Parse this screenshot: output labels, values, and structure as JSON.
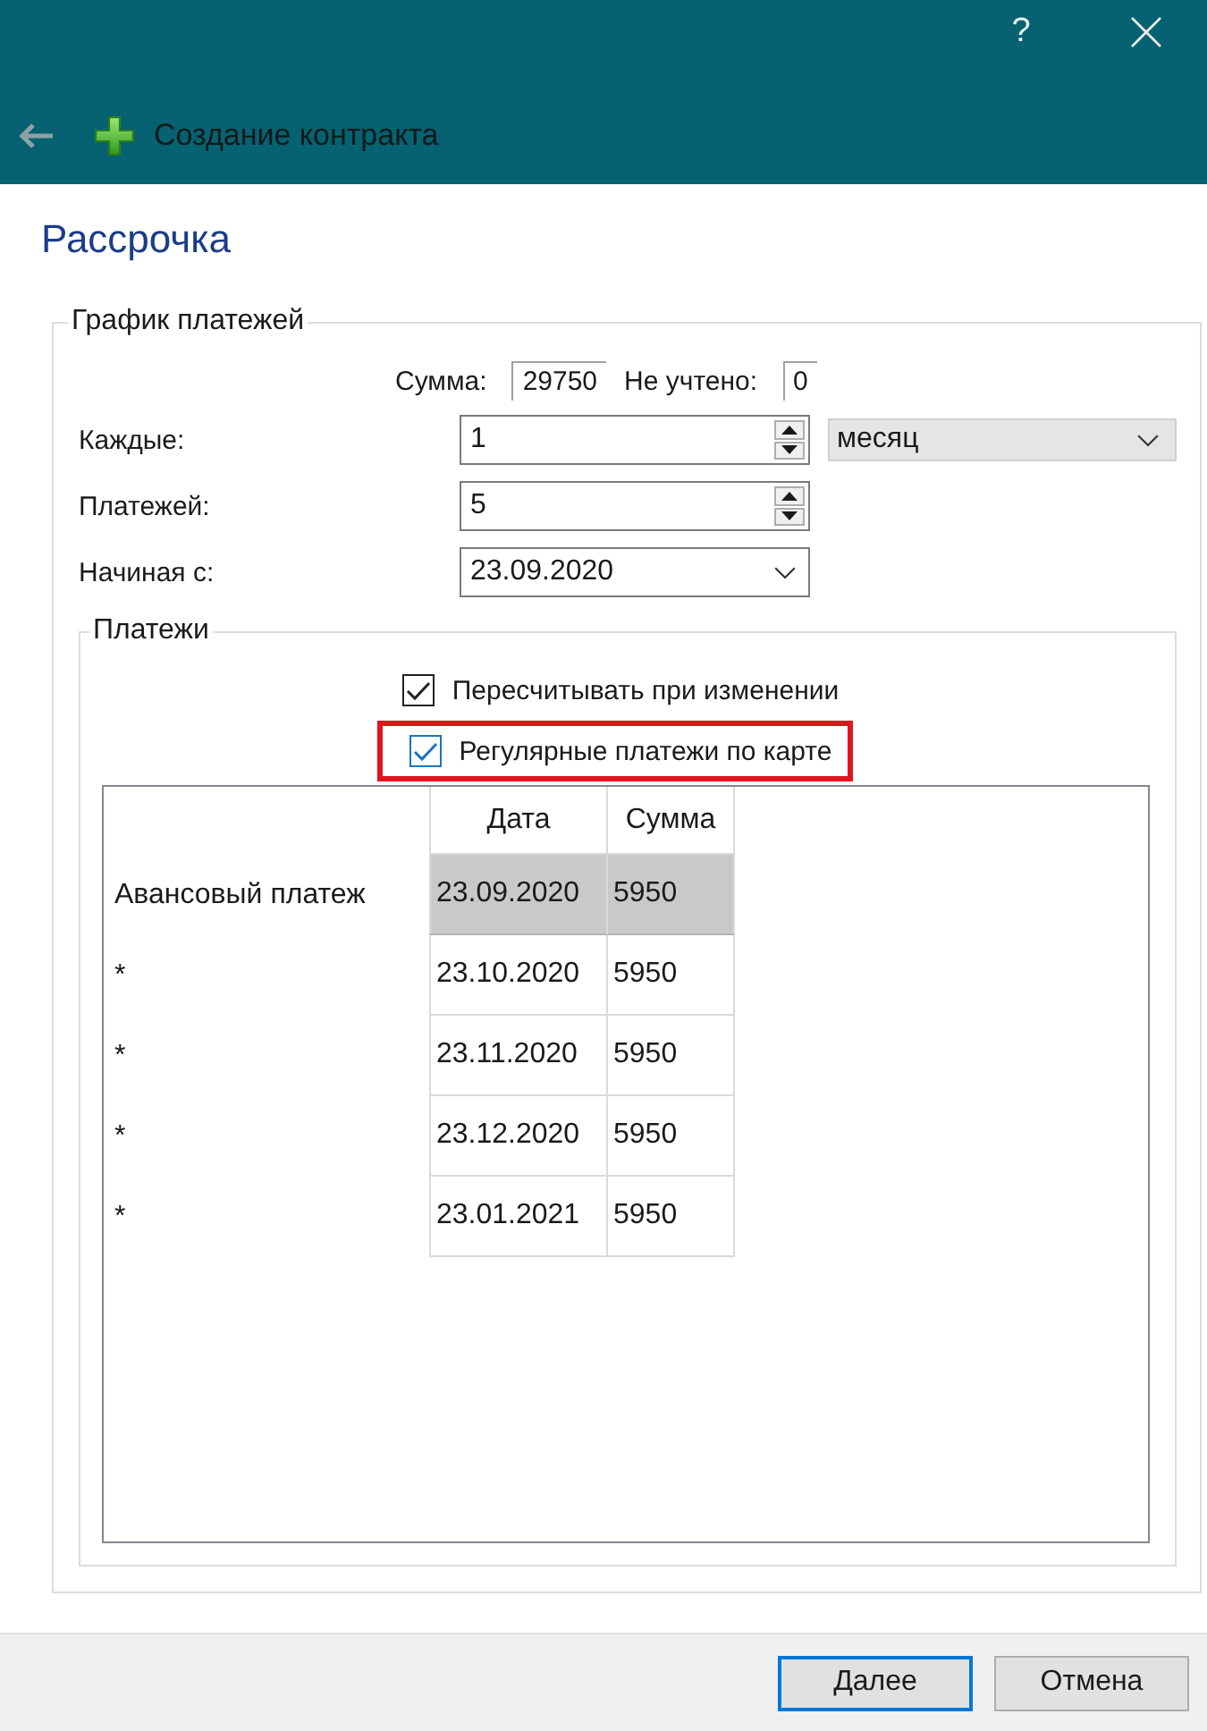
{
  "window": {
    "help": "?"
  },
  "toolbar": {
    "title": "Создание контракта"
  },
  "page_title": "Рассрочка",
  "schedule": {
    "legend": "График платежей",
    "totals": [
      {
        "label": "Сумма:",
        "value": "29750"
      },
      {
        "label": "Не учтено:",
        "value": "0"
      }
    ],
    "fields": [
      {
        "kind": "spin",
        "label": "Каждые:",
        "value": "1",
        "unit": "месяц"
      },
      {
        "kind": "spin",
        "label": "Платежей:",
        "value": "5"
      },
      {
        "kind": "date",
        "label": "Начиная с:",
        "value": "23.09.2020"
      }
    ],
    "payments": {
      "legend": "Платежи",
      "checkboxes": [
        {
          "label": "Пересчитывать при изменении",
          "checked": true,
          "color": "#222222",
          "highlighted": false
        },
        {
          "label": "Регулярные платежи по карте",
          "checked": true,
          "color": "#1a73c6",
          "highlighted": true
        }
      ],
      "table": {
        "columns": [
          "Дата",
          "Сумма"
        ],
        "rows": [
          {
            "header": "Авансовый платеж",
            "cells": [
              "23.09.2020",
              "5950"
            ],
            "selected": true
          },
          {
            "header": "*",
            "cells": [
              "23.10.2020",
              "5950"
            ],
            "selected": false
          },
          {
            "header": "*",
            "cells": [
              "23.11.2020",
              "5950"
            ],
            "selected": false
          },
          {
            "header": "*",
            "cells": [
              "23.12.2020",
              "5950"
            ],
            "selected": false
          },
          {
            "header": "*",
            "cells": [
              "23.01.2021",
              "5950"
            ],
            "selected": false
          }
        ]
      }
    }
  },
  "buttons": [
    {
      "label": "Далее",
      "default": true
    },
    {
      "label": "Отмена",
      "default": false
    }
  ]
}
